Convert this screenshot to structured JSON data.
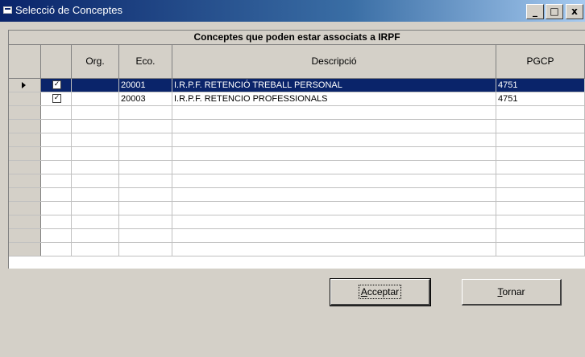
{
  "window": {
    "title": "Selecció de Conceptes",
    "controls": {
      "minimize": "_",
      "maximize": "□",
      "close": "x"
    }
  },
  "grid": {
    "caption": "Conceptes que poden estar associats a IRPF",
    "columns": [
      "",
      "",
      "Org.",
      "Eco.",
      "Descripció",
      "PGCP"
    ],
    "rows": [
      {
        "checked": true,
        "org": "",
        "eco": "20001",
        "descripcio": "I.R.P.F. RETENCIÓ TREBALL PERSONAL",
        "pgcp": "4751",
        "selected": true
      },
      {
        "checked": true,
        "org": "",
        "eco": "20003",
        "descripcio": "I.R.P.F. RETENCIO PROFESSIONALS",
        "pgcp": "4751",
        "selected": false
      }
    ],
    "empty_rows": 11
  },
  "buttons": {
    "accept": {
      "mnemonic": "A",
      "rest": "cceptar"
    },
    "return": {
      "mnemonic": "T",
      "rest": "ornar"
    }
  },
  "colors": {
    "selection": "#0a246a",
    "face": "#d4d0c8"
  }
}
